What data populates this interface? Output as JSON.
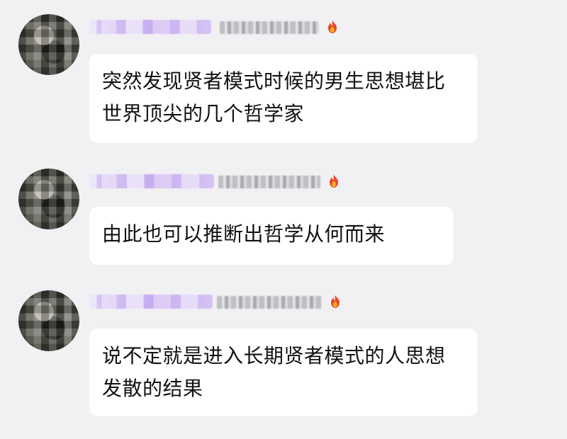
{
  "messages": [
    {
      "avatar": "pixelated-avatar",
      "name": "pixelated-name",
      "meta": "pixelated-title",
      "badge_icon": "fire-icon",
      "text": "突然发现贤者模式时候的男生思想堪比世界顶尖的几个哲学家"
    },
    {
      "avatar": "pixelated-avatar",
      "name": "pixelated-name",
      "meta": "pixelated-title",
      "badge_icon": "fire-icon",
      "text": "由此也可以推断出哲学从何而来"
    },
    {
      "avatar": "pixelated-avatar",
      "name": "pixelated-name",
      "meta": "pixelated-title",
      "badge_icon": "fire-icon",
      "text": "说不定就是进入长期贤者模式的人思想发散的结果"
    }
  ],
  "colors": {
    "background": "#f1f1f3",
    "bubble": "#ffffff",
    "name_badge": "#c7adf0",
    "text": "#111111"
  }
}
